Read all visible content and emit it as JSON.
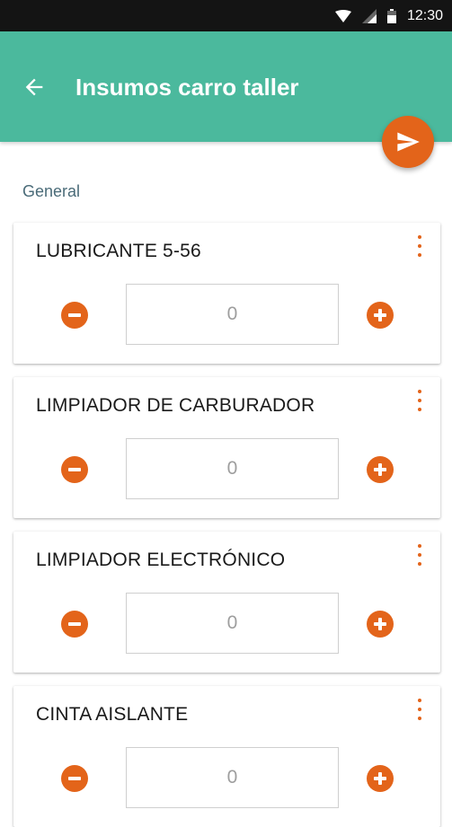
{
  "status_bar": {
    "time": "12:30",
    "icons": [
      "wifi-icon",
      "signal-icon",
      "battery-icon"
    ]
  },
  "app_bar": {
    "title": "Insumos carro taller",
    "back_icon": "arrow-back-icon",
    "color": "#4bb99d"
  },
  "fab": {
    "icon": "send-icon",
    "color": "#e3641a"
  },
  "section": {
    "label": "General"
  },
  "items": [
    {
      "name": "LUBRICANTE 5-56",
      "quantity": "0"
    },
    {
      "name": "LIMPIADOR DE CARBURADOR",
      "quantity": "0"
    },
    {
      "name": "LIMPIADOR ELECTRÓNICO",
      "quantity": "0"
    },
    {
      "name": "CINTA AISLANTE",
      "quantity": "0"
    }
  ],
  "accent_color": "#e3641a"
}
